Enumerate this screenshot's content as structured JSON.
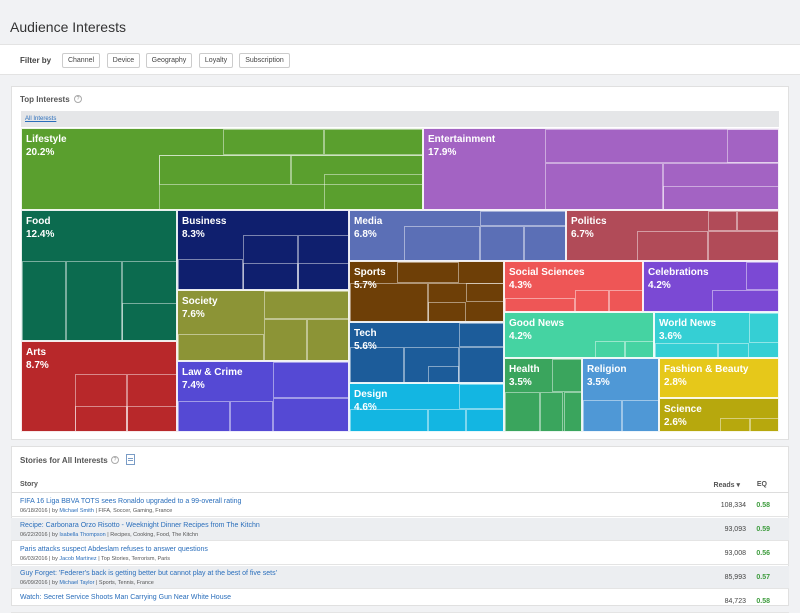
{
  "page": {
    "title": "Audience Interests"
  },
  "filters": {
    "label": "Filter by",
    "items": [
      "Channel",
      "Device",
      "Geography",
      "Loyalty",
      "Subscription"
    ]
  },
  "top_interests": {
    "title": "Top Interests",
    "breadcrumb": "All Interests",
    "tiles": [
      {
        "name": "Lifestyle",
        "pct": "20.2%",
        "color": "#5a9f2e"
      },
      {
        "name": "Entertainment",
        "pct": "17.9%",
        "color": "#a363c3"
      },
      {
        "name": "Food",
        "pct": "12.4%",
        "color": "#0c6b4f"
      },
      {
        "name": "Arts",
        "pct": "8.7%",
        "color": "#b8282a"
      },
      {
        "name": "Business",
        "pct": "8.3%",
        "color": "#0f1f6e"
      },
      {
        "name": "Society",
        "pct": "7.6%",
        "color": "#8c9436"
      },
      {
        "name": "Law & Crime",
        "pct": "7.4%",
        "color": "#5549d4"
      },
      {
        "name": "Media",
        "pct": "6.8%",
        "color": "#5b6fb6"
      },
      {
        "name": "Politics",
        "pct": "6.7%",
        "color": "#b14b58"
      },
      {
        "name": "Sports",
        "pct": "5.7%",
        "color": "#6e3f07"
      },
      {
        "name": "Tech",
        "pct": "5.6%",
        "color": "#1c5c9a"
      },
      {
        "name": "Design",
        "pct": "4.6%",
        "color": "#13b6e2"
      },
      {
        "name": "Social Sciences",
        "pct": "4.3%",
        "color": "#ee5656"
      },
      {
        "name": "Celebrations",
        "pct": "4.2%",
        "color": "#7b49d4"
      },
      {
        "name": "Good News",
        "pct": "4.2%",
        "color": "#45d3a2"
      },
      {
        "name": "World News",
        "pct": "3.6%",
        "color": "#35cfd4"
      },
      {
        "name": "Health",
        "pct": "3.5%",
        "color": "#3aa55d"
      },
      {
        "name": "Religion",
        "pct": "3.5%",
        "color": "#4f98d6"
      },
      {
        "name": "Fashion & Beauty",
        "pct": "2.8%",
        "color": "#e6c81a"
      },
      {
        "name": "Science",
        "pct": "2.6%",
        "color": "#b7a80d"
      }
    ]
  },
  "stories": {
    "title": "Stories for All Interests",
    "columns": {
      "story": "Story",
      "reads": "Reads ▾",
      "eq": "EQ"
    },
    "rows": [
      {
        "title": "FIFA 16 Liga BBVA TOTS sees Ronaldo upgraded to a 99-overall rating",
        "date": "06/18/2016 | by",
        "author": "Michael Smith",
        "tags": "| FIFA, Soccer, Gaming, France",
        "reads": "108,334",
        "eq": "0.58"
      },
      {
        "title": "Recipe: Carbonara Orzo Risotto - Weeknight Dinner Recipes from The Kitchn",
        "date": "06/22/2016 | by",
        "author": "Isabella Thompson",
        "tags": "| Recipes, Cooking, Food, The Kitchn",
        "reads": "93,093",
        "eq": "0.59"
      },
      {
        "title": "Paris attacks suspect Abdeslam refuses to answer questions",
        "date": "06/03/2016 | by",
        "author": "Jacob Martinez",
        "tags": "| Top Stories, Terrorism, Paris",
        "reads": "93,008",
        "eq": "0.56"
      },
      {
        "title": "Guy Forget: 'Federer's back is getting better but cannot play at the best of five sets'",
        "date": "06/09/2016 | by",
        "author": "Michael Taylor",
        "tags": "| Sports, Tennis, France",
        "reads": "85,993",
        "eq": "0.57"
      },
      {
        "title": "Watch: Secret Service Shoots Man Carrying Gun Near White House",
        "date": "",
        "author": "",
        "tags": "",
        "reads": "84,723",
        "eq": "0.58"
      }
    ]
  }
}
